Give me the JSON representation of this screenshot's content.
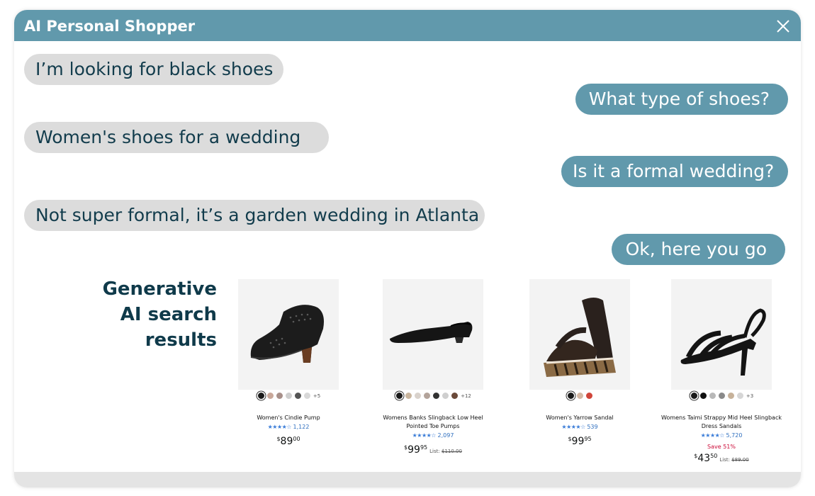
{
  "app": {
    "title": "AI Personal Shopper"
  },
  "colors": {
    "header": "#6199ac",
    "bot_bubble": "#6199ac",
    "user_bubble": "#dcdcdc",
    "user_text": "#123c4c",
    "heading": "#0f3a4a",
    "stars": "#3b7dd8",
    "sale": "#cc0c39"
  },
  "chat": {
    "messages": [
      {
        "role": "user",
        "text": "I’m looking for black shoes"
      },
      {
        "role": "assistant",
        "text": "What type of shoes?"
      },
      {
        "role": "user",
        "text": "Women's shoes for a wedding"
      },
      {
        "role": "assistant",
        "text": "Is it a formal wedding?"
      },
      {
        "role": "user",
        "text": "Not super formal, it’s a garden wedding in Atlanta"
      },
      {
        "role": "assistant",
        "text": "Ok, here you go"
      }
    ]
  },
  "results": {
    "heading_lines": [
      "Generative",
      "AI search",
      "results"
    ],
    "products": [
      {
        "name": "Women's Cindie Pump",
        "stars": "★★★★☆",
        "rating_count": "1,122",
        "price_currency": "$",
        "price_whole": "89",
        "price_fraction": "00",
        "swatches": [
          "#1a1a1a",
          "#c9a89a",
          "#a8908a",
          "#cfcfcf",
          "#555555",
          "#d8d8d8"
        ],
        "more_colors": "+5"
      },
      {
        "name": "Womens Banks Slingback Low Heel Pointed Toe Pumps",
        "stars": "★★★★☆",
        "rating_count": "2,097",
        "price_currency": "$",
        "price_whole": "99",
        "price_fraction": "95",
        "list_label": "List:",
        "list_price": "$110.00",
        "swatches": [
          "#1a1a1a",
          "#c9b59e",
          "#d9d2cc",
          "#b3a39a",
          "#333333",
          "#cfcfcf",
          "#6b4a3a"
        ],
        "more_colors": "+12"
      },
      {
        "name": "Women's Yarrow Sandal",
        "stars": "★★★★☆",
        "rating_count": "539",
        "price_currency": "$",
        "price_whole": "99",
        "price_fraction": "95",
        "swatches": [
          "#1a1a1a",
          "#d5b9a5",
          "#d0453a"
        ]
      },
      {
        "name": "Womens Taimi Strappy Mid Heel Slingback Dress Sandals",
        "stars": "★★★★☆",
        "rating_count": "5,720",
        "save_text": "Save 51%",
        "price_currency": "$",
        "price_whole": "43",
        "price_fraction": "50",
        "list_label": "List:",
        "list_price": "$89.00",
        "swatches": [
          "#1a1a1a",
          "#111111",
          "#b8b8b8",
          "#8a8a8a",
          "#c7b29a",
          "#d6d6d6"
        ],
        "more_colors": "+3"
      }
    ]
  }
}
